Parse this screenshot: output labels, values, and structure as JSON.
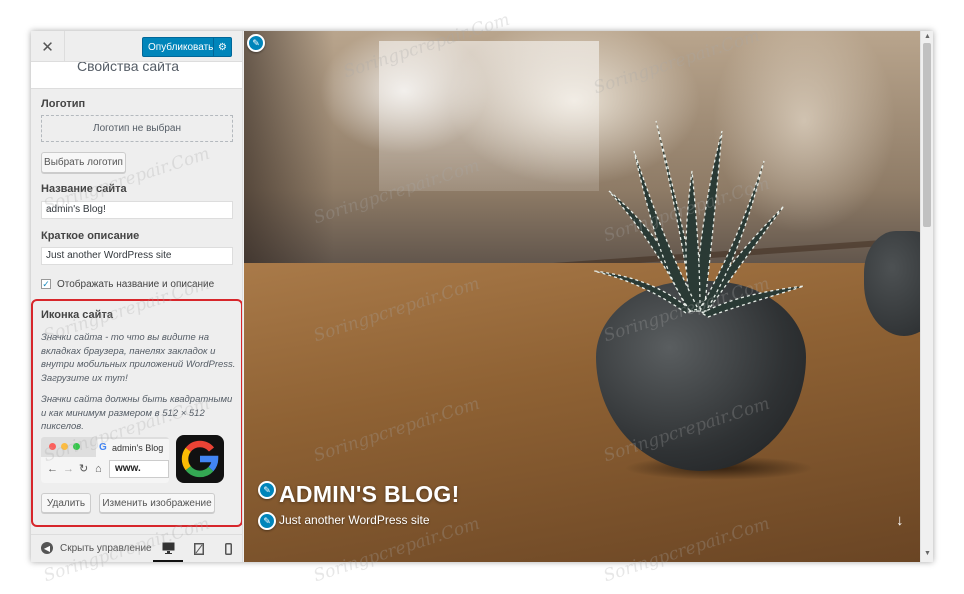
{
  "header": {
    "close_icon": "close-icon",
    "publish_label": "Опубликовать",
    "publish_gear_icon": "gear-icon",
    "section_title": "Свойства сайта"
  },
  "logo": {
    "label": "Логотип",
    "placeholder": "Логотип не выбран",
    "select_button": "Выбрать логотип"
  },
  "site_title": {
    "label": "Название сайта",
    "value": "admin's Blog!"
  },
  "tagline": {
    "label": "Краткое описание",
    "value": "Just another WordPress site"
  },
  "display_title_tagline": {
    "checked": true,
    "label": "Отображать название и описание"
  },
  "site_icon": {
    "title": "Иконка сайта",
    "description_1": "Значки сайта - то что вы видите на вкладках браузера, панелях закладок и внутри мобильных приложений WordPress. Загрузите их тут!",
    "description_2": "Значки сайта должны быть квадратными и как минимум размером в 512 × 512 пикселов.",
    "browser_tab_text": "admin's Blog",
    "browser_url_text": "www.",
    "remove_button": "Удалить",
    "change_button": "Изменить изображение",
    "highlight_color": "#d7262b"
  },
  "footer": {
    "collapse_label": "Скрыть управление",
    "devices": [
      "desktop-icon",
      "tablet-icon",
      "mobile-icon"
    ]
  },
  "preview": {
    "blog_title": "ADMIN'S BLOG!",
    "blog_tagline": "Just another WordPress site",
    "scroll_down_icon": "arrow-down-icon"
  },
  "watermark_text": "Soringpcrepair.Com",
  "colors": {
    "accent": "#0085ba",
    "publish_border": "#006799"
  }
}
